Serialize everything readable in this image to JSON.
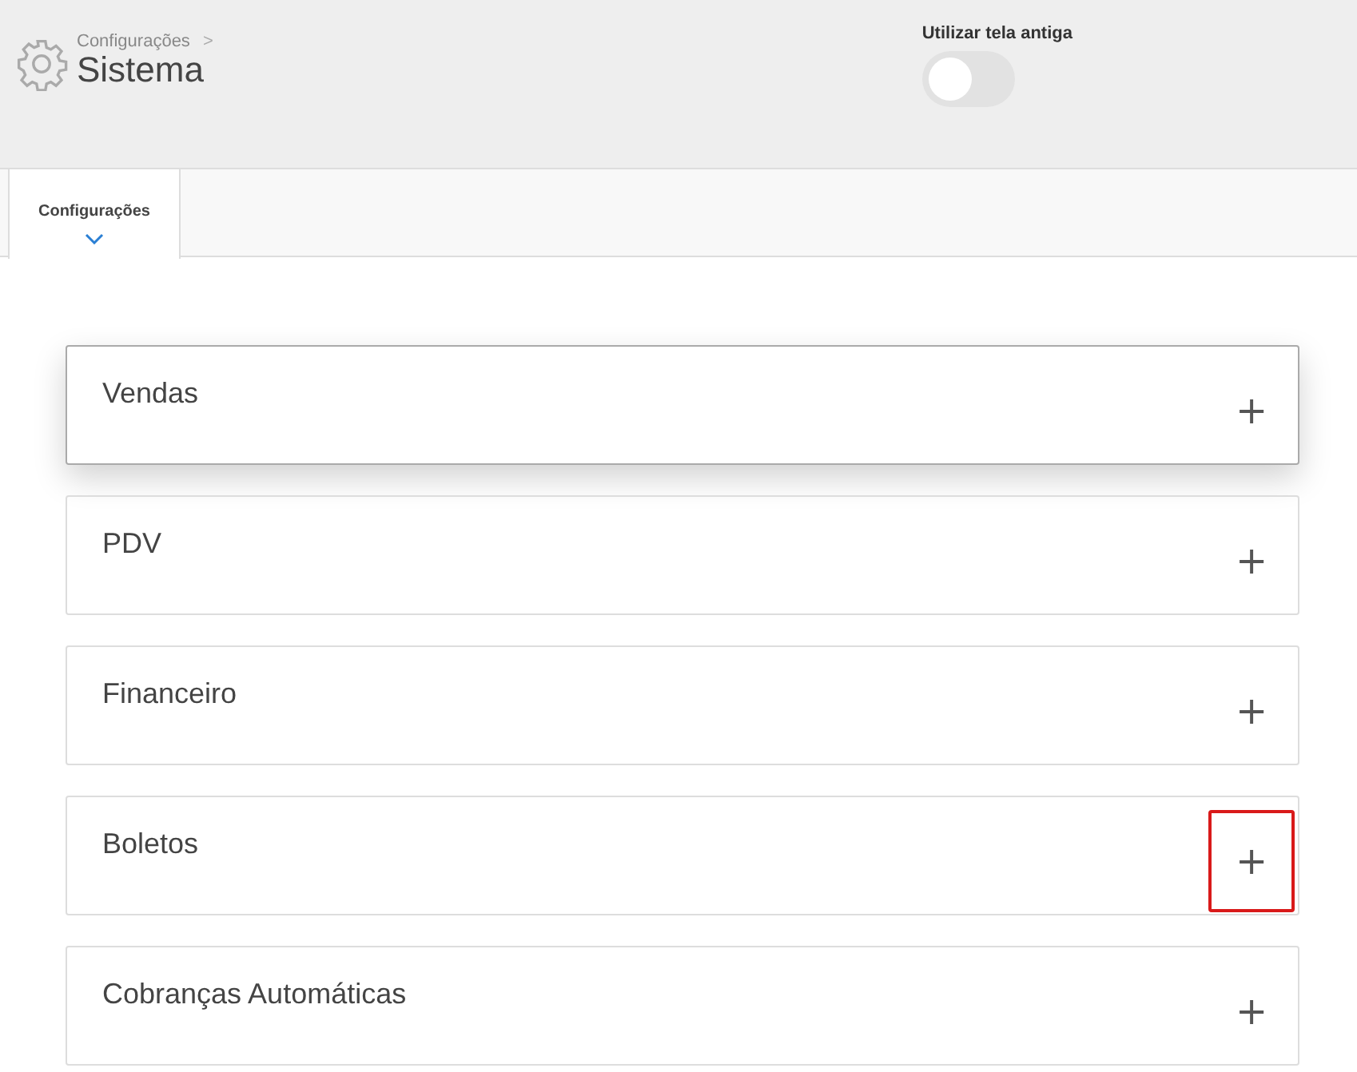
{
  "breadcrumb": {
    "parent": "Configurações",
    "separator": ">",
    "title": "Sistema"
  },
  "toggle": {
    "label": "Utilizar tela antiga",
    "on": false
  },
  "tabs": [
    {
      "label": "Configurações",
      "selected": true
    }
  ],
  "sections": [
    {
      "title": "Vendas",
      "expand": "+",
      "focused": true,
      "highlighted": false
    },
    {
      "title": "PDV",
      "expand": "+",
      "focused": false,
      "highlighted": false
    },
    {
      "title": "Financeiro",
      "expand": "+",
      "focused": false,
      "highlighted": false
    },
    {
      "title": "Boletos",
      "expand": "+",
      "focused": false,
      "highlighted": true
    },
    {
      "title": "Cobranças Automáticas",
      "expand": "+",
      "focused": false,
      "highlighted": false
    }
  ]
}
